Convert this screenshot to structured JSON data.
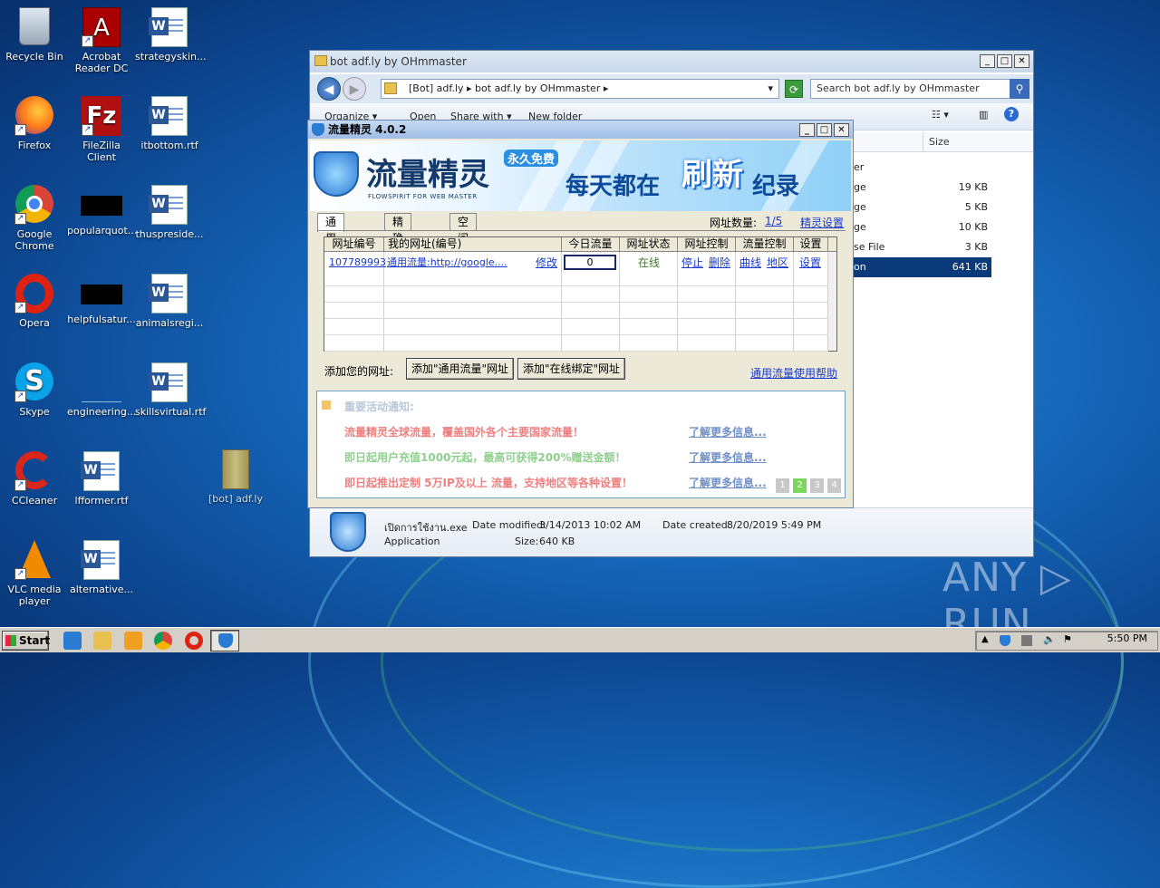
{
  "desktop": {
    "icons": [
      {
        "label": "Recycle Bin"
      },
      {
        "label": "Acrobat Reader DC"
      },
      {
        "label": "strategyskin..."
      },
      {
        "label": "Firefox"
      },
      {
        "label": "FileZilla Client"
      },
      {
        "label": "itbottom.rtf"
      },
      {
        "label": "Google Chrome"
      },
      {
        "label": "popularquot..."
      },
      {
        "label": "thuspreside..."
      },
      {
        "label": "Opera"
      },
      {
        "label": "helpfulsatur..."
      },
      {
        "label": "animalsregi..."
      },
      {
        "label": "Skype"
      },
      {
        "label": "engineering..."
      },
      {
        "label": "skillsvirtual.rtf"
      },
      {
        "label": "CCleaner"
      },
      {
        "label": "lfformer.rtf"
      },
      {
        "label": "[bot] adf.ly"
      },
      {
        "label": "VLC media player"
      },
      {
        "label": "alternative..."
      }
    ]
  },
  "explorer": {
    "title": "bot adf.ly by OHmmaster",
    "breadcrumb": "[Bot] adf.ly  ▸  bot adf.ly by OHmmaster  ▸",
    "search_placeholder": "Search bot adf.ly by OHmmaster",
    "toolbar": {
      "organize": "Organize ▾",
      "open": "Open",
      "share": "Share with ▾",
      "new_folder": "New folder"
    },
    "col_size": "Size",
    "files": [
      {
        "type_fragment": "er",
        "size": ""
      },
      {
        "type_fragment": "ge",
        "size": "19 KB"
      },
      {
        "type_fragment": "ge",
        "size": "5 KB"
      },
      {
        "type_fragment": "ge",
        "size": "10 KB"
      },
      {
        "type_fragment": "se File",
        "size": "3 KB"
      },
      {
        "type_fragment": "on",
        "size": "641 KB"
      }
    ],
    "details": {
      "name": "เปิดการใช้งาน.exe",
      "modified_label": "Date modified:",
      "modified": "3/14/2013 10:02 AM",
      "created_label": "Date created:",
      "created": "8/20/2019 5:49 PM",
      "type": "Application",
      "size_label": "Size:",
      "size": "640 KB"
    }
  },
  "app": {
    "title": "流量精灵 4.0.2",
    "banner": {
      "name": "流量精灵",
      "sub": "FLOWSPIRIT FOR WEB MASTER",
      "free": "永久免费",
      "slogan1": "每天都在",
      "slogan2": "刷新",
      "slogan3": "纪录"
    },
    "tabs": [
      "通用流量",
      "精确流量",
      "空间人气"
    ],
    "url_count_label": "网址数量:",
    "url_count": "1/5",
    "settings_link": "精灵设置",
    "grid": {
      "headers": [
        "网址编号",
        "我的网址(编号)",
        "今日流量",
        "网址状态",
        "网址控制",
        "流量控制",
        "设置"
      ],
      "row": {
        "id": "107789993",
        "url": "通用流量:http://google....",
        "edit": "修改",
        "today": "0",
        "status": "在线",
        "stop": "停止",
        "delete": "删除",
        "curve": "曲线",
        "region": "地区",
        "settings": "设置"
      }
    },
    "add_label": "添加您的网址:",
    "add_general_button": "添加\"通用流量\"网址",
    "add_online_button": "添加\"在线绑定\"网址",
    "help_link": "通用流量使用帮助",
    "notice": {
      "title": "重要活动通知:",
      "items": [
        {
          "text": "流量精灵全球流量，覆盖国外各个主要国家流量！",
          "more": "了解更多信息...",
          "color": "#f08080"
        },
        {
          "text": "即日起用户充值1000元起，最高可获得200%赠送金额！",
          "more": "了解更多信息...",
          "color": "#8fd08f"
        },
        {
          "text": "即日起推出定制 5万IP及以上 流量，支持地区等各种设置！",
          "more": "了解更多信息...",
          "color": "#f08080"
        }
      ],
      "pages": [
        "1",
        "2",
        "3",
        "4"
      ],
      "active_page": "2"
    }
  },
  "taskbar": {
    "start": "Start",
    "clock": "5:50 PM"
  },
  "watermark": "ANY ▷ RUN"
}
